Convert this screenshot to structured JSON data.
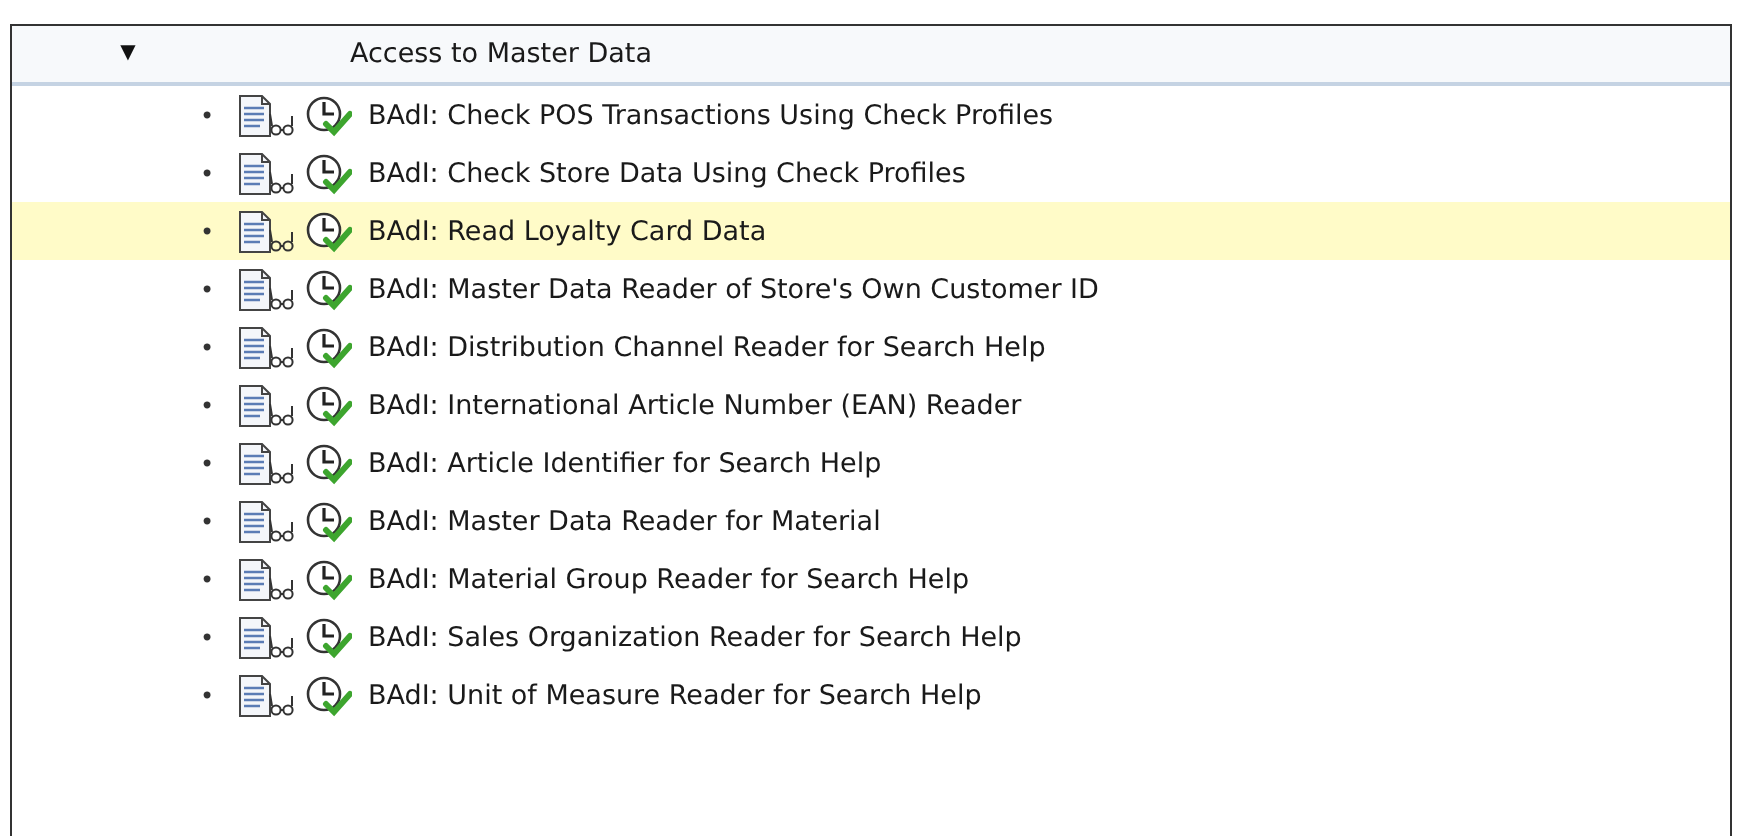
{
  "header": {
    "toggle": "▼",
    "expanded": true,
    "title": "Access to Master Data"
  },
  "rows": [
    {
      "bullet": "•",
      "text": "BAdI: Check POS Transactions Using Check Profiles",
      "selected": false
    },
    {
      "bullet": "•",
      "text": "BAdI: Check Store Data Using Check Profiles",
      "selected": false
    },
    {
      "bullet": "•",
      "text": "BAdI: Read Loyalty Card Data",
      "selected": true
    },
    {
      "bullet": "•",
      "text": "BAdI: Master Data Reader of Store's Own Customer ID",
      "selected": false
    },
    {
      "bullet": "•",
      "text": "BAdI: Distribution Channel Reader for Search Help",
      "selected": false
    },
    {
      "bullet": "•",
      "text": "BAdI: International Article Number (EAN) Reader",
      "selected": false
    },
    {
      "bullet": "•",
      "text": "BAdI: Article Identifier for Search Help",
      "selected": false
    },
    {
      "bullet": "•",
      "text": "BAdI: Master Data Reader for Material",
      "selected": false
    },
    {
      "bullet": "•",
      "text": "BAdI: Material Group Reader for Search Help",
      "selected": false
    },
    {
      "bullet": "•",
      "text": "BAdI: Sales Organization Reader for Search Help",
      "selected": false
    },
    {
      "bullet": "•",
      "text": "BAdI: Unit of Measure Reader for Search Help",
      "selected": false
    }
  ]
}
